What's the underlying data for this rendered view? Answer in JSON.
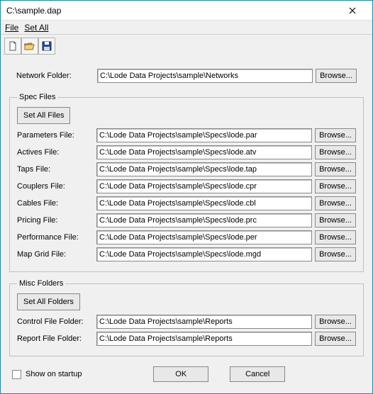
{
  "window": {
    "title": "C:\\sample.dap"
  },
  "menu": {
    "file": "File",
    "setAll": "Set All"
  },
  "fields": {
    "networkFolder": {
      "label": "Network Folder:",
      "value": "C:\\Lode Data Projects\\sample\\Networks"
    }
  },
  "specFiles": {
    "legend": "Spec Files",
    "setAllBtn": "Set All Files",
    "items": [
      {
        "label": "Parameters File:",
        "value": "C:\\Lode Data Projects\\sample\\Specs\\lode.par"
      },
      {
        "label": "Actives File:",
        "value": "C:\\Lode Data Projects\\sample\\Specs\\lode.atv"
      },
      {
        "label": "Taps File:",
        "value": "C:\\Lode Data Projects\\sample\\Specs\\lode.tap"
      },
      {
        "label": "Couplers File:",
        "value": "C:\\Lode Data Projects\\sample\\Specs\\lode.cpr"
      },
      {
        "label": "Cables File:",
        "value": "C:\\Lode Data Projects\\sample\\Specs\\lode.cbl"
      },
      {
        "label": "Pricing File:",
        "value": "C:\\Lode Data Projects\\sample\\Specs\\lode.prc"
      },
      {
        "label": "Performance File:",
        "value": "C:\\Lode Data Projects\\sample\\Specs\\lode.per"
      },
      {
        "label": "Map Grid File:",
        "value": "C:\\Lode Data Projects\\sample\\Specs\\lode.mgd"
      }
    ]
  },
  "miscFolders": {
    "legend": "Misc Folders",
    "setAllBtn": "Set All Folders",
    "items": [
      {
        "label": "Control File Folder:",
        "value": "C:\\Lode Data Projects\\sample\\Reports"
      },
      {
        "label": "Report File Folder:",
        "value": "C:\\Lode Data Projects\\sample\\Reports"
      }
    ]
  },
  "buttons": {
    "browse": "Browse...",
    "ok": "OK",
    "cancel": "Cancel"
  },
  "checkbox": {
    "showOnStartup": "Show on startup"
  }
}
